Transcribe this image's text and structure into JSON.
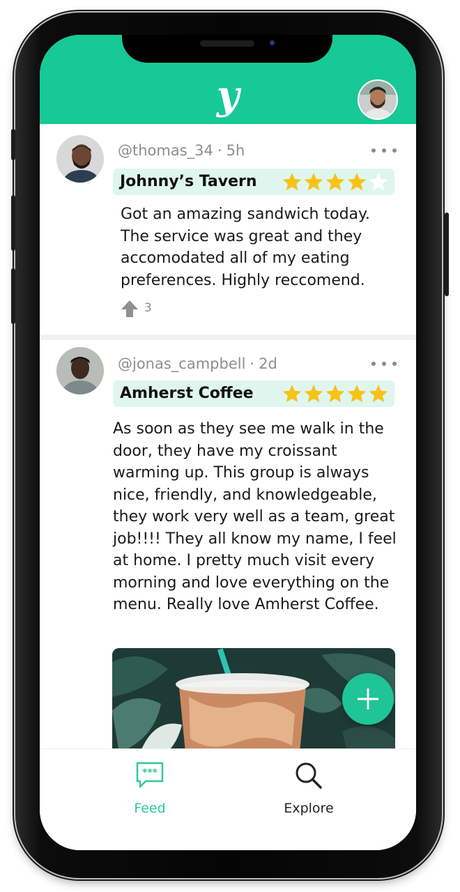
{
  "app": {
    "logo_text": "y",
    "brand_color": "#16c997",
    "highlight_color": "#dff6ef",
    "star_color": "#f7c218"
  },
  "posts": [
    {
      "username": "@thomas_34",
      "time_ago": "5h",
      "place": "Johnny’s Tavern",
      "rating": 4,
      "max_rating": 5,
      "text": "Got an amazing sandwich today. The service was great and they accomodated all of my eating preferences. Highly reccomend.",
      "upvotes": "3",
      "upvote_icon": "arrow-up-icon",
      "more_icon": "more-horizontal-icon"
    },
    {
      "username": "@jonas_campbell",
      "time_ago": "2d",
      "place": "Amherst Coffee",
      "rating": 5,
      "max_rating": 5,
      "text": "As soon as they see me walk in the door, they have my croissant warming up. This group is always nice, friendly, and knowledgeable, they work very well as a team, great job!!!! They all know my name, I feel at home. I pretty much visit every morning and love everything on the menu. Really love Amherst Coffee.",
      "more_icon": "more-horizontal-icon",
      "image_icon": "iced-coffee-photo"
    }
  ],
  "fab": {
    "icon": "plus-icon"
  },
  "nav": [
    {
      "label": "Feed",
      "icon": "chat-bubble-icon",
      "active": true
    },
    {
      "label": "Explore",
      "icon": "search-icon",
      "active": false
    }
  ]
}
